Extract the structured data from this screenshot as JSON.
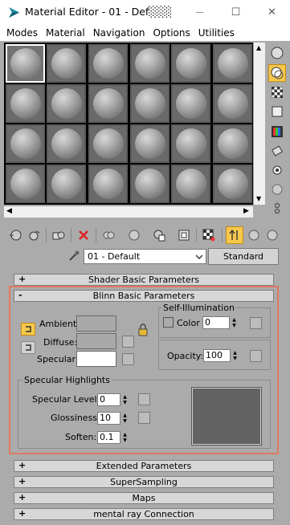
{
  "window": {
    "title": "Material Editor - 01 - Def░░░",
    "minimize_icon": "minimize-icon",
    "maximize_icon": "maximize-icon",
    "close_icon": "close-icon",
    "minimize_glyph": "—",
    "maximize_glyph": "☐",
    "close_glyph": "✕"
  },
  "menu": [
    "Modes",
    "Material",
    "Navigation",
    "Options",
    "Utilities"
  ],
  "material": {
    "name": "01 - Default",
    "type_button": "Standard"
  },
  "rollouts": {
    "shader": {
      "sign": "+",
      "label": "Shader Basic Parameters"
    },
    "blinn": {
      "sign": "-",
      "label": "Blinn Basic Parameters"
    },
    "extended": {
      "sign": "+",
      "label": "Extended Parameters"
    },
    "supersampling": {
      "sign": "+",
      "label": "SuperSampling"
    },
    "maps": {
      "sign": "+",
      "label": "Maps"
    },
    "mental_ray": {
      "sign": "+",
      "label": "mental ray Connection"
    }
  },
  "blinn": {
    "ambient": "Ambient:",
    "diffuse": "Diffuse:",
    "specular": "Specular:",
    "ambient_color": "#a9a9a9",
    "diffuse_color": "#a9a9a9",
    "specular_color": "#ffffff",
    "self_illum_title": "Self-Illumination",
    "color_label": "Color",
    "self_illum_value": "0",
    "opacity_label": "Opacity:",
    "opacity_value": "100",
    "spec_title": "Specular Highlights",
    "spec_level_label": "Specular Level:",
    "spec_level_value": "0",
    "gloss_label": "Glossiness:",
    "gloss_value": "10",
    "soften_label": "Soften:",
    "soften_value": "0.1",
    "preview_color": "#636363"
  },
  "colors": {
    "accent": "#f6c84c",
    "highlight_border": "#e07a5f",
    "background": "#ababab"
  }
}
